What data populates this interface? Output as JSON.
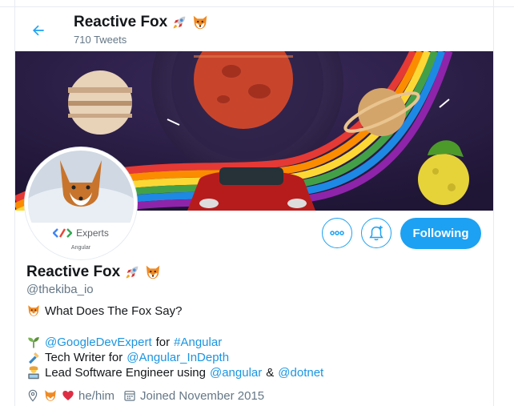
{
  "header": {
    "title": "Reactive Fox",
    "tweet_count": "710 Tweets"
  },
  "avatar": {
    "badge_title": "Experts",
    "badge_subtitle": "Angular"
  },
  "actions": {
    "following_label": "Following"
  },
  "profile": {
    "name": "Reactive Fox",
    "handle": "@thekiba_io",
    "bio": {
      "line1": "What Does The Fox Say?",
      "line2": {
        "mention": "@GoogleDevExpert",
        "joiner": "for",
        "hashtag": "#Angular"
      },
      "line3": {
        "text": "Tech Writer for",
        "mention": "@Angular_InDepth"
      },
      "line4": {
        "text": "Lead Software Engineer using",
        "mention1": "@angular",
        "joiner": "&",
        "mention2": "@dotnet"
      }
    },
    "pronouns": "he/him",
    "joined": "Joined November 2015"
  },
  "colors": {
    "accent": "#1da1f2",
    "link": "#1b95e0",
    "secondary_text": "#657786"
  },
  "icons": [
    "back-arrow-icon",
    "rocket-icon",
    "fox-icon",
    "more-icon",
    "bell-plus-icon",
    "location-icon",
    "heart-icon",
    "calendar-icon",
    "seedling-icon",
    "writing-hand-icon",
    "technologist-icon"
  ]
}
